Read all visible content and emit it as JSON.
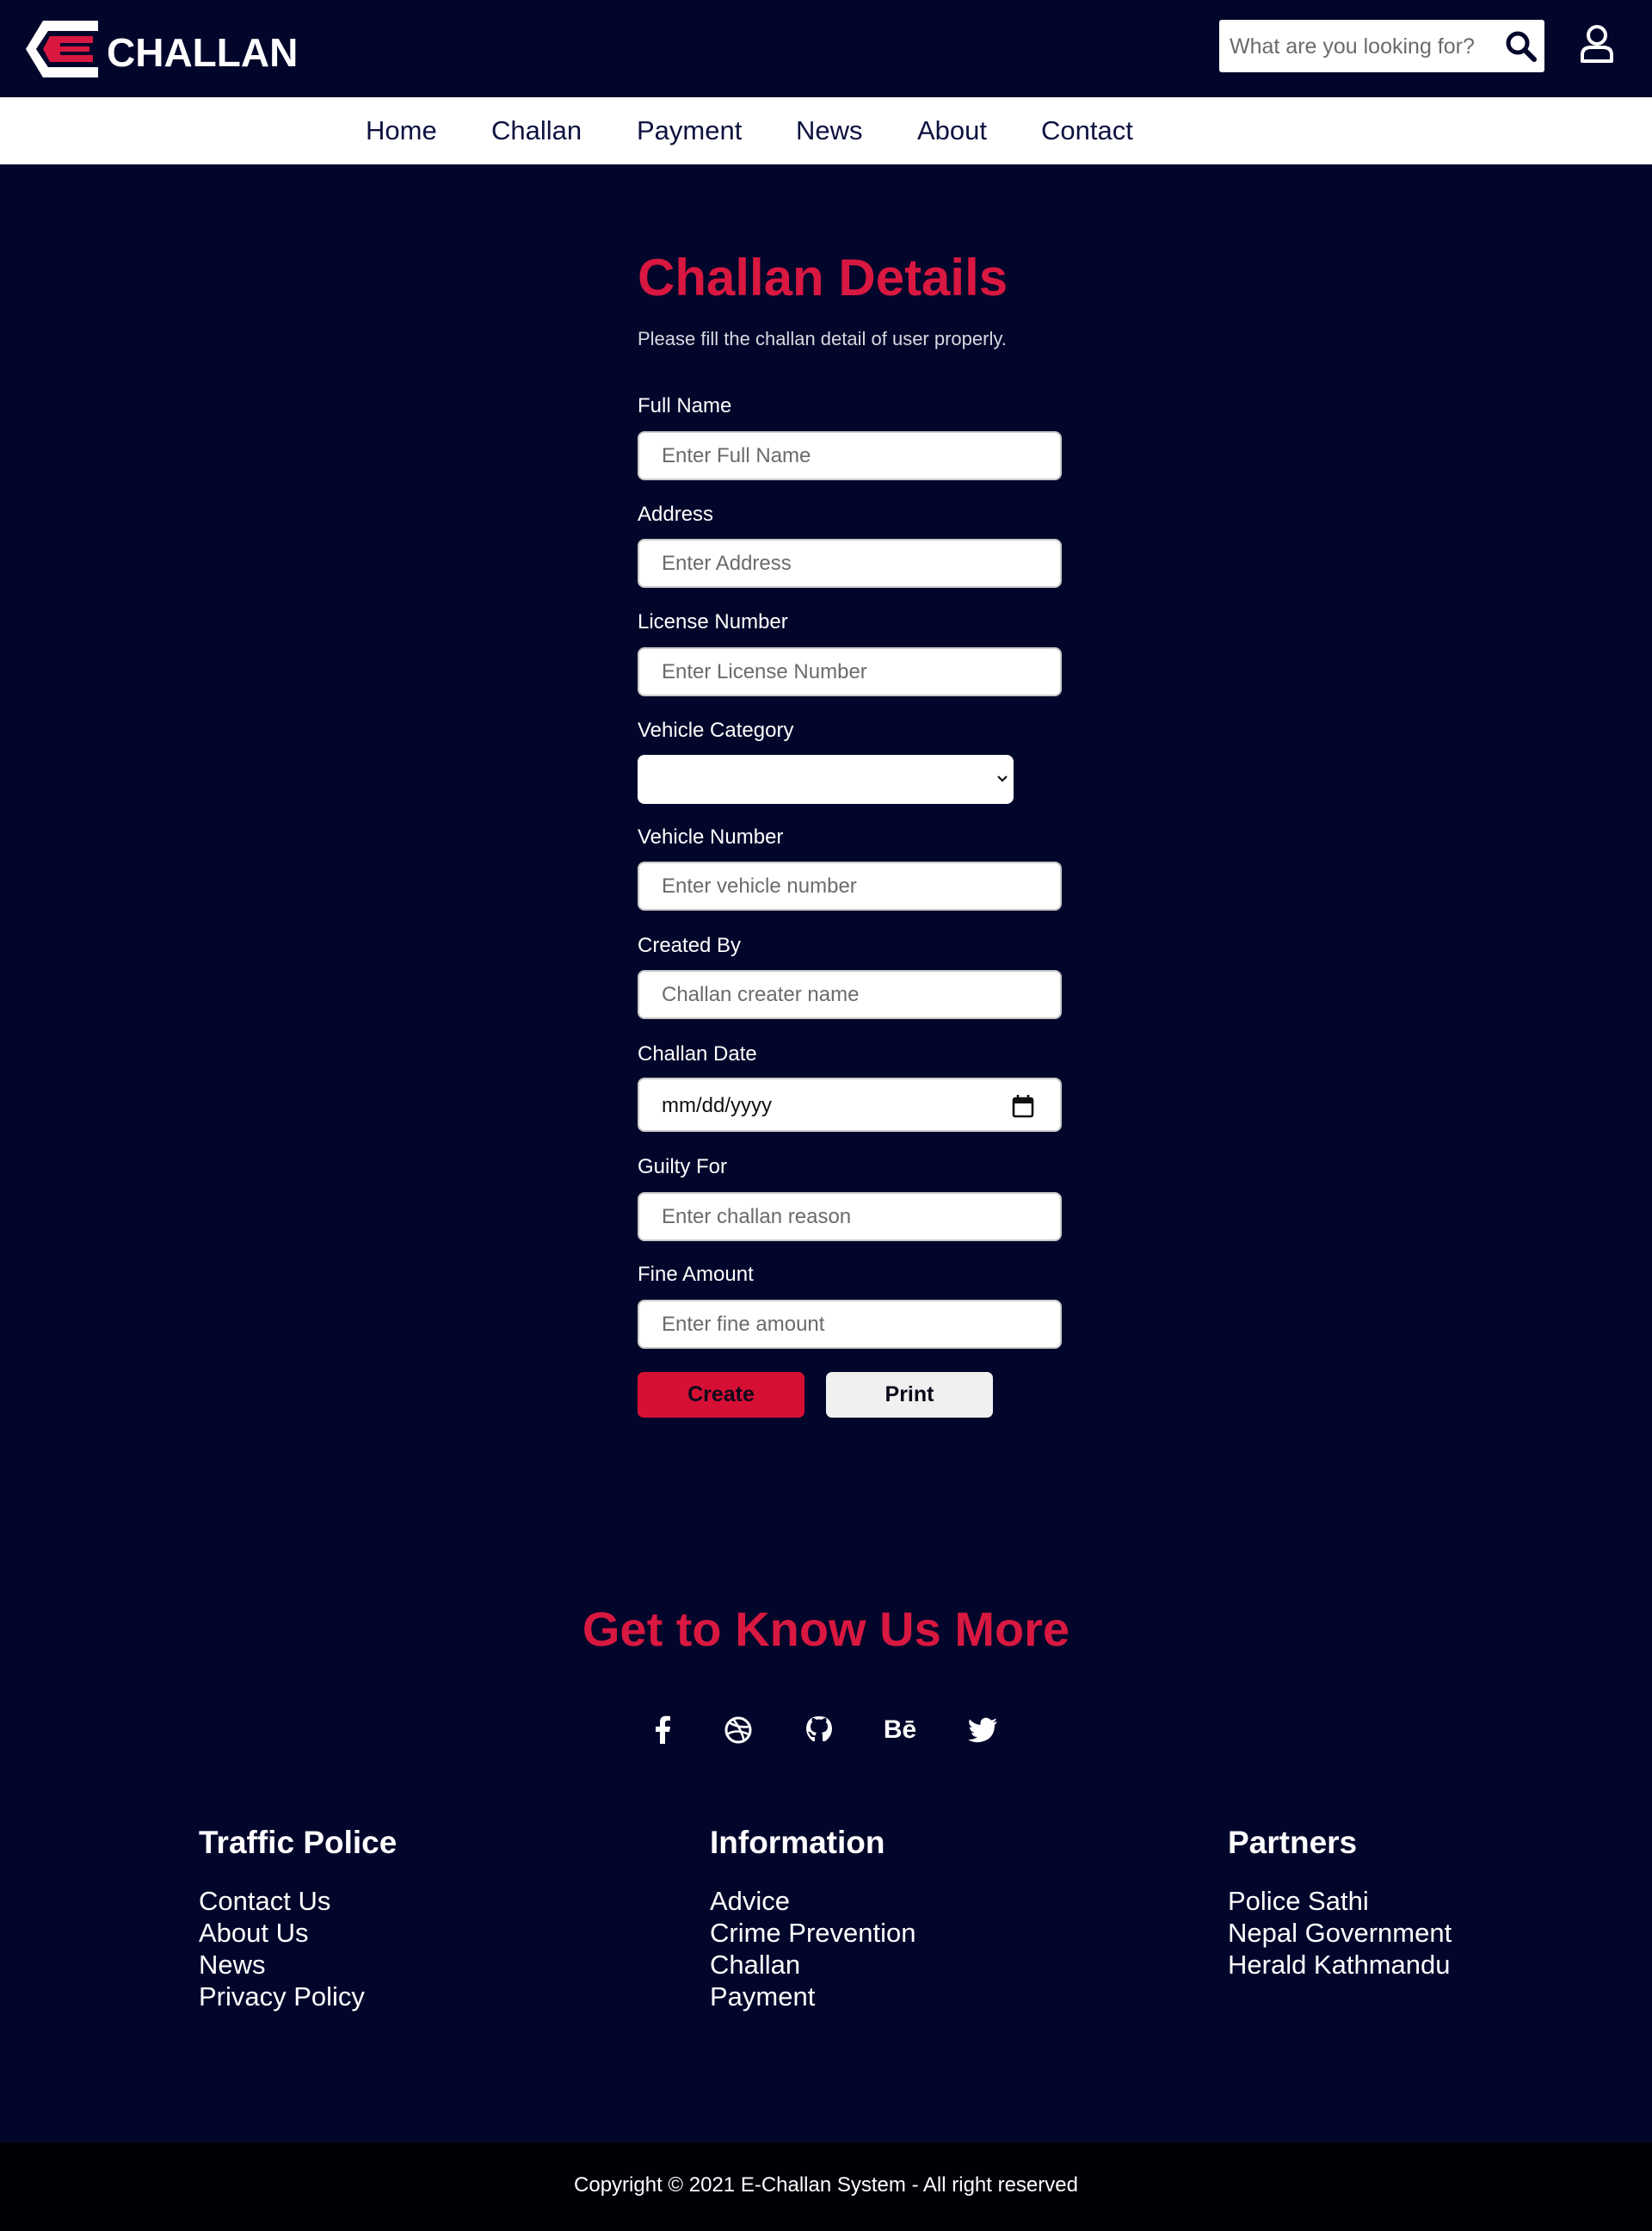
{
  "header": {
    "logo_text": "CHALLAN",
    "search_placeholder": "What are you looking for?",
    "icons": {
      "search": "search-icon",
      "user": "user-icon"
    }
  },
  "nav": {
    "items": [
      {
        "label": "Home"
      },
      {
        "label": "Challan"
      },
      {
        "label": "Payment"
      },
      {
        "label": "News"
      },
      {
        "label": "About"
      },
      {
        "label": "Contact"
      }
    ]
  },
  "form": {
    "title": "Challan Details",
    "subtitle": "Please fill the challan detail of user properly.",
    "fields": {
      "full_name": {
        "label": "Full Name",
        "placeholder": "Enter Full Name"
      },
      "address": {
        "label": "Address",
        "placeholder": "Enter Address"
      },
      "license_number": {
        "label": "License Number",
        "placeholder": "Enter License Number"
      },
      "vehicle_category": {
        "label": "Vehicle Category",
        "value": ""
      },
      "vehicle_number": {
        "label": "Vehicle Number",
        "placeholder": "Enter vehicle number"
      },
      "created_by": {
        "label": "Created By",
        "placeholder": "Challan creater name"
      },
      "challan_date": {
        "label": "Challan Date",
        "value": "mm/dd/yyyy"
      },
      "guilty_for": {
        "label": "Guilty For",
        "placeholder": "Enter challan reason"
      },
      "fine_amount": {
        "label": "Fine Amount",
        "placeholder": "Enter fine amount"
      }
    },
    "buttons": {
      "create": "Create",
      "print": "Print"
    }
  },
  "social": {
    "title": "Get to Know Us More",
    "icons": [
      "facebook-icon",
      "dribbble-icon",
      "github-icon",
      "behance-icon",
      "twitter-icon"
    ],
    "behance_text": "Bē"
  },
  "footer": {
    "columns": [
      {
        "title": "Traffic Police",
        "links": [
          "Contact Us",
          "About Us",
          "News",
          "Privacy Policy"
        ]
      },
      {
        "title": "Information",
        "links": [
          "Advice",
          "Crime Prevention",
          "Challan",
          "Payment"
        ]
      },
      {
        "title": "Partners",
        "links": [
          "Police Sathi",
          "Nepal Government",
          "Herald Kathmandu"
        ]
      }
    ],
    "copyright": "Copyright © 2021 E-Challan System - All right reserved"
  },
  "colors": {
    "background": "#03062b",
    "accent": "#d81840",
    "nav_bg": "#ffffff",
    "copyright_bg": "#000007"
  }
}
